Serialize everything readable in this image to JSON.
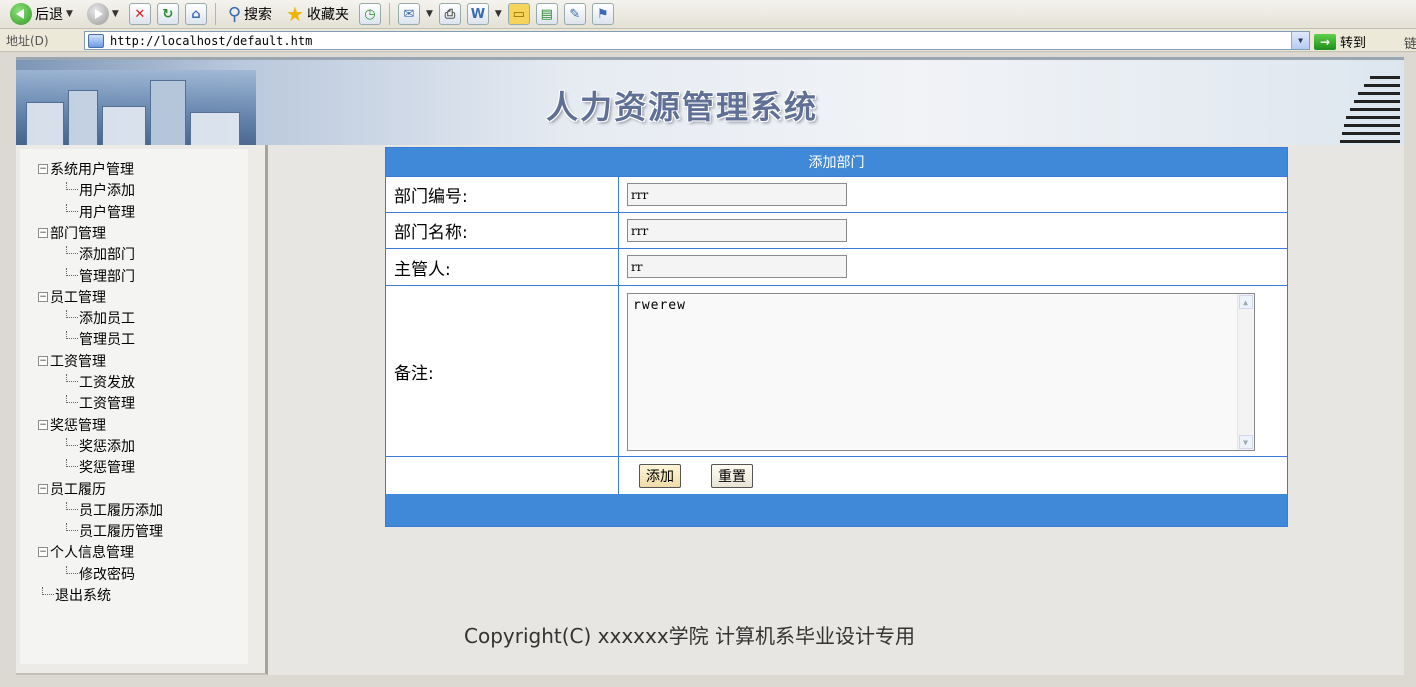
{
  "browser": {
    "toolbar": {
      "back_label": "后退",
      "search_label": "搜索",
      "favorites_label": "收藏夹"
    },
    "address": {
      "label": "地址(D)",
      "url": "http://localhost/default.htm",
      "go_label": "转到",
      "links_label": "链"
    }
  },
  "banner": {
    "title": "人力资源管理系统"
  },
  "sidebar": {
    "groups": [
      {
        "label": "系统用户管理",
        "children": [
          "用户添加",
          "用户管理"
        ]
      },
      {
        "label": "部门管理",
        "children": [
          "添加部门",
          "管理部门"
        ]
      },
      {
        "label": "员工管理",
        "children": [
          "添加员工",
          "管理员工"
        ]
      },
      {
        "label": "工资管理",
        "children": [
          "工资发放",
          "工资管理"
        ]
      },
      {
        "label": "奖惩管理",
        "children": [
          "奖惩添加",
          "奖惩管理"
        ]
      },
      {
        "label": "员工履历",
        "children": [
          "员工履历添加",
          "员工履历管理"
        ]
      },
      {
        "label": "个人信息管理",
        "children": [
          "修改密码"
        ]
      }
    ],
    "logout": "退出系统"
  },
  "form": {
    "title": "添加部门",
    "dept_no_label": "部门编号:",
    "dept_no_value": "rrr",
    "dept_name_label": "部门名称:",
    "dept_name_value": "rrr",
    "manager_label": "主管人:",
    "manager_value": "rr",
    "remark_label": "备注:",
    "remark_value": "rwerew",
    "add_button": "添加",
    "reset_button": "重置"
  },
  "footer": {
    "copyright": "Copyright(C) xxxxxx学院 计算机系毕业设计专用"
  },
  "colors": {
    "form_header": "#3f89d8",
    "form_border": "#3a7bd5",
    "banner_title": "#5f6f95"
  }
}
